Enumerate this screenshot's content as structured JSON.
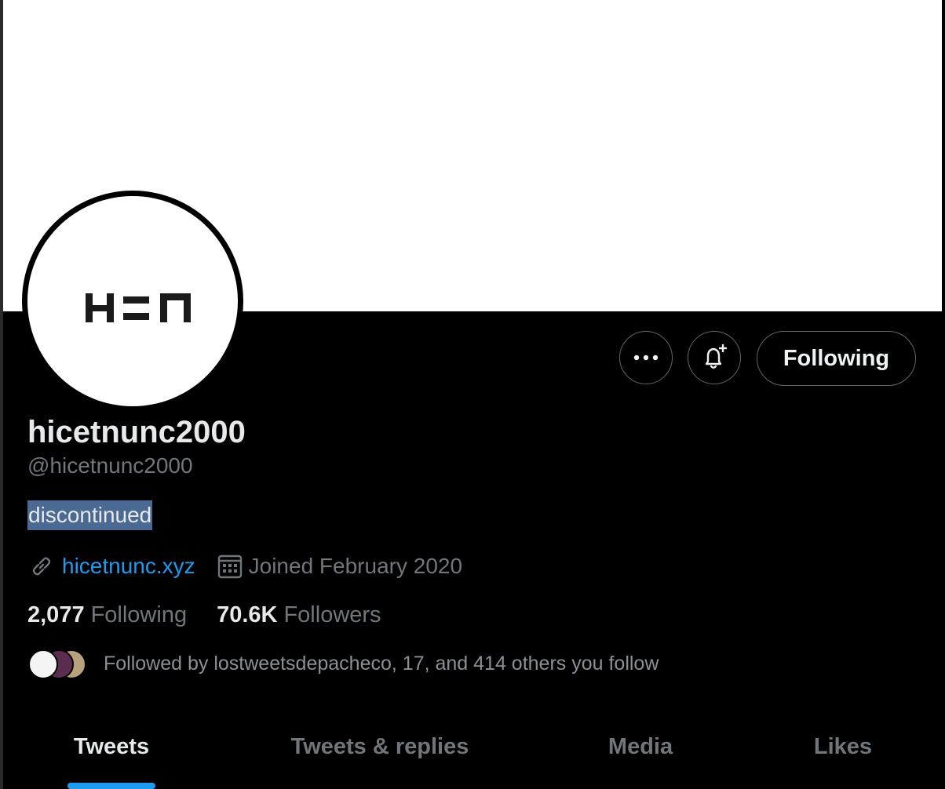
{
  "profile": {
    "display_name": "hicetnunc2000",
    "handle": "@hicetnunc2000",
    "bio": "discontinued",
    "website": "hicetnunc.xyz",
    "joined": "Joined February 2020",
    "avatar_logo": "H=N"
  },
  "actions": {
    "more_icon": "more-horizontal-icon",
    "notify_icon": "bell-plus-icon",
    "following_label": "Following"
  },
  "stats": {
    "following_count": "2,077",
    "following_label": "Following",
    "followers_count": "70.6K",
    "followers_label": "Followers"
  },
  "followed_by": "Followed by lostweetsdepacheco, 17, and 414 others you follow",
  "tabs": [
    {
      "label": "Tweets",
      "active": true
    },
    {
      "label": "Tweets & replies",
      "active": false
    },
    {
      "label": "Media",
      "active": false
    },
    {
      "label": "Likes",
      "active": false
    }
  ],
  "colors": {
    "accent": "#1d9bf0",
    "background": "#000000",
    "primary_text": "#e7e9ea",
    "secondary_text": "#71767b",
    "selection": "#4a6a94"
  }
}
